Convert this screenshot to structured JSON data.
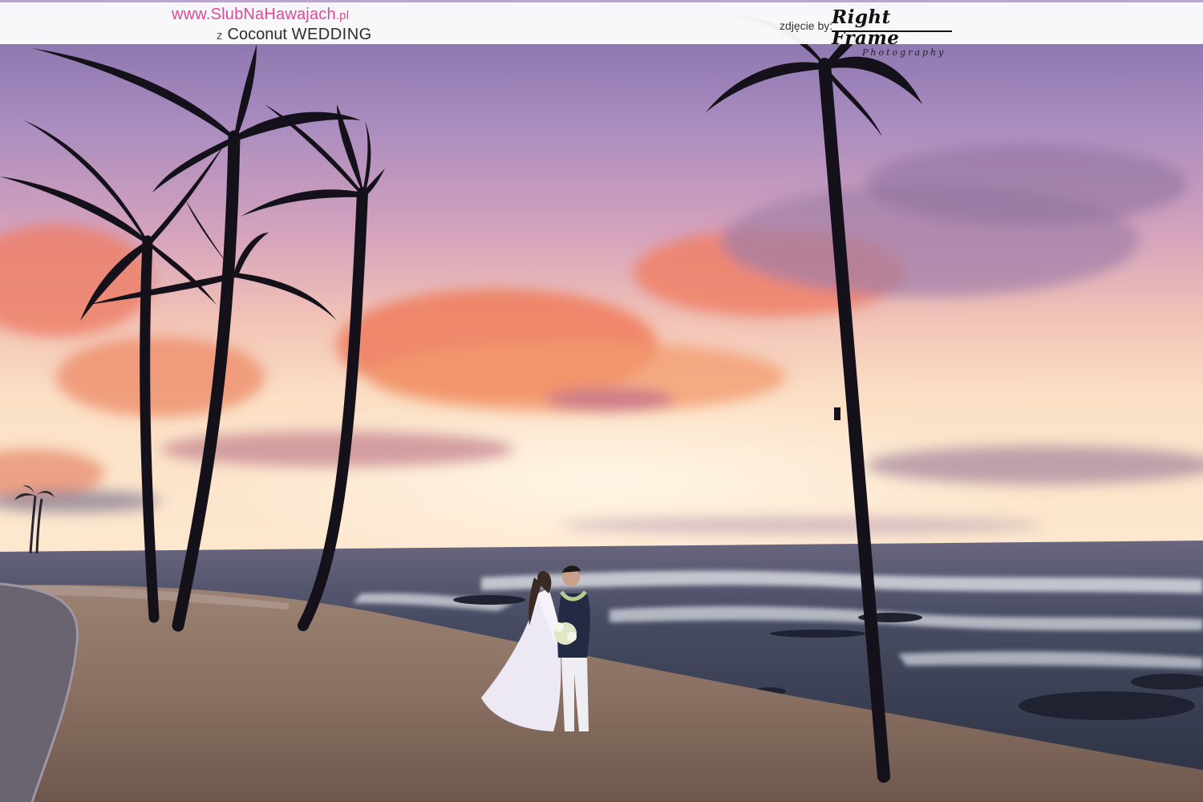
{
  "header": {
    "site_url_main": "www.SlubNaHawajach",
    "site_url_tld": ".pl",
    "site_prefix": "z",
    "site_name_a": "Coconut",
    "site_name_b": "WEDDING",
    "photo_credit_label": "zdjęcie by:",
    "photographer_name": "Right Frame",
    "photographer_tag": "Photography"
  },
  "colors": {
    "brand_pink": "#e0489a",
    "sky_top": "#8d78b0",
    "sky_glow": "#f27b5c",
    "horizon": "#fbd2a4",
    "sea": "#40455a",
    "sand": "#8e7567"
  }
}
